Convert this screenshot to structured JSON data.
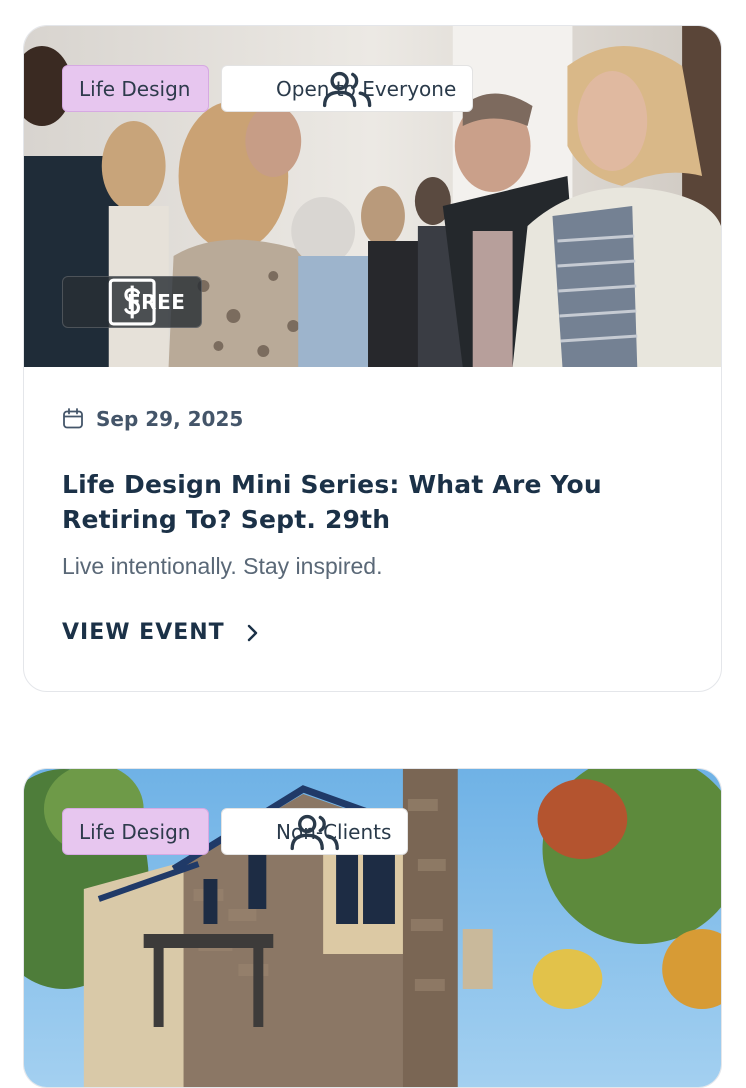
{
  "events": [
    {
      "category": "Life Design",
      "audience": "Open to Everyone",
      "audience_icon": "people-icon",
      "price": "FREE",
      "price_icon": "dollar-icon",
      "date": "Sep 29, 2025",
      "date_icon": "calendar-icon",
      "title": "Life Design Mini Series: What Are You Retiring To? Sept. 29th",
      "subtitle": "Live intentionally. Stay inspired.",
      "cta": "VIEW EVENT",
      "cta_icon": "chevron-right-icon"
    },
    {
      "category": "Life Design",
      "audience": "Non-Clients",
      "audience_icon": "people-icon"
    }
  ],
  "colors": {
    "category_chip": "#e7c6ef",
    "heading": "#1b3147",
    "muted_text": "#5a6877"
  }
}
